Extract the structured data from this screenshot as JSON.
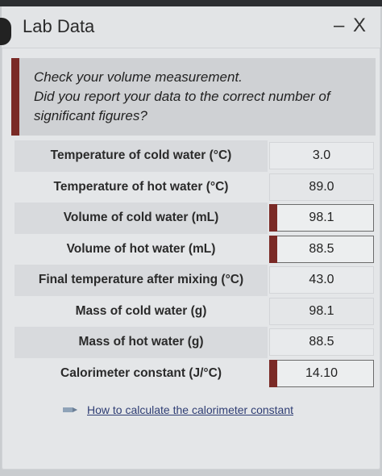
{
  "window": {
    "title": "Lab Data",
    "controls": "– X"
  },
  "feedback": {
    "line1": "Check your volume measurement.",
    "line2": "Did you report your data to the correct number of significant figures?"
  },
  "rows": [
    {
      "label": "Temperature of cold water (°C)",
      "value": "3.0",
      "flagged": false
    },
    {
      "label": "Temperature of hot water (°C)",
      "value": "89.0",
      "flagged": false
    },
    {
      "label": "Volume of cold water (mL)",
      "value": "98.1",
      "flagged": true
    },
    {
      "label": "Volume of hot water (mL)",
      "value": "88.5",
      "flagged": true
    },
    {
      "label": "Final temperature after mixing (°C)",
      "value": "43.0",
      "flagged": false
    },
    {
      "label": "Mass of cold water (g)",
      "value": "98.1",
      "flagged": false
    },
    {
      "label": "Mass of hot water (g)",
      "value": "88.5",
      "flagged": false
    },
    {
      "label": "Calorimeter constant (J/°C)",
      "value": "14.10",
      "flagged": true
    }
  ],
  "help": {
    "link_text": "How to calculate the calorimeter constant",
    "icon": "pencil-tag-icon"
  },
  "colors": {
    "flag": "#7a2a26",
    "link": "#2f3e74"
  }
}
